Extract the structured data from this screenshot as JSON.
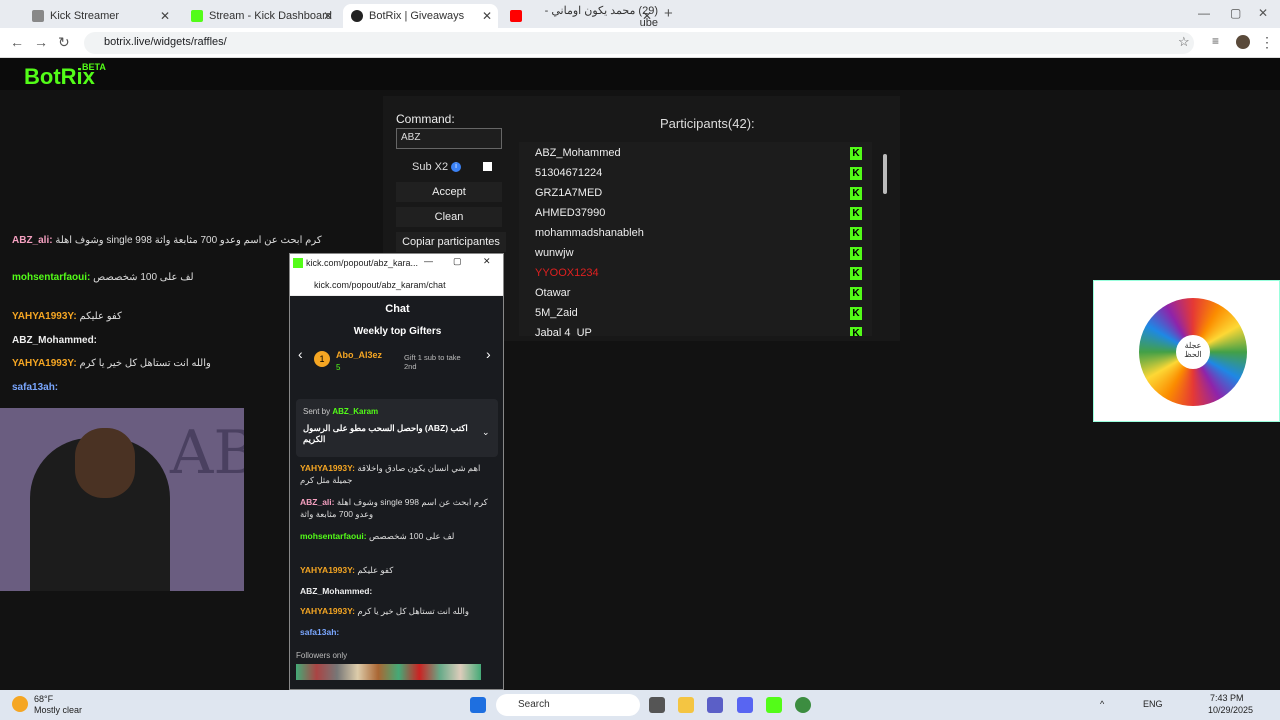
{
  "browser": {
    "tabs": [
      {
        "label": "Kick Streamer",
        "active": false
      },
      {
        "label": "Stream - Kick Dashboard",
        "active": false
      },
      {
        "label": "BotRix | Giveaways",
        "active": true
      },
      {
        "label": "(29) محمد يكون اوماني - ube",
        "active": false
      }
    ],
    "url": "botrix.live/widgets/raffles/"
  },
  "site": {
    "logo": "BotRix",
    "logo_badge": "BETA",
    "command_label": "Command:",
    "command_value": "ABZ",
    "sub_x2_label": "Sub X2",
    "accept_label": "Accept",
    "clean_label": "Clean",
    "copy_label": "Copiar participantes",
    "participants_title": "Participants(42):",
    "participants": [
      {
        "name": "ABZ_Mohammed",
        "highlight": false
      },
      {
        "name": "51304671224",
        "highlight": false
      },
      {
        "name": "GRZ1A7MED",
        "highlight": false
      },
      {
        "name": "AHMED37990",
        "highlight": false
      },
      {
        "name": "mohammadshanableh",
        "highlight": false
      },
      {
        "name": "wunwjw",
        "highlight": false
      },
      {
        "name": "YYOOX1234",
        "highlight": true
      },
      {
        "name": "Otawar",
        "highlight": false
      },
      {
        "name": "5M_Zaid",
        "highlight": false
      },
      {
        "name": "Jabal 4_UP",
        "highlight": false
      }
    ],
    "wheel_label": "عجلة الحظ"
  },
  "stream_chat": [
    {
      "user": "ABZ_ali:",
      "text": "وشوف اهلة single 998 كرم ابحث عن اسم وعدو 700 مثابعة واثة"
    },
    {
      "user": "mohsentarfaoui:",
      "text": "لف على 100 شخصصص"
    },
    {
      "user": "YAHYA1993Y:",
      "text": "كفو عليكم"
    },
    {
      "user": "ABZ_Mohammed:",
      "text": ""
    },
    {
      "user": "YAHYA1993Y:",
      "text": "والله انت تستاهل كل خير يا كرم"
    },
    {
      "user": "safa13ah:",
      "text": ""
    }
  ],
  "popup": {
    "title": "kick.com/popout/abz_kara...",
    "url": "kick.com/popout/abz_karam/chat",
    "chat_header": "Chat",
    "gifters_title": "Weekly top Gifters",
    "top_gifter": "Abo_Al3ez",
    "top_gifter_count": "5",
    "gift_hint": "Gift 1 sub to take 2nd",
    "pinned_by": "Sent by",
    "pinned_user": "ABZ_Karam",
    "pinned_text": "واحصل السحب مطو على الرسول (ABZ) اكتب الكريم",
    "messages": [
      {
        "user": "YAHYA1993Y:",
        "text": "اهم شي انسان يكون صادق واخلاقة جميلة مثل كرم",
        "color": "yellow"
      },
      {
        "user": "ABZ_ali:",
        "text": "وشوف اهلة single 998 كرم ابحث عن اسم وعدو 700 مثابعة واثة",
        "color": "pink"
      },
      {
        "user": "mohsentarfaoui:",
        "text": "لف على 100 شخصصص",
        "color": "green"
      },
      {
        "user": "YAHYA1993Y:",
        "text": "كفو عليكم",
        "color": "yellow"
      },
      {
        "user": "ABZ_Mohammed:",
        "text": "",
        "color": "white"
      },
      {
        "user": "YAHYA1993Y:",
        "text": "والله انت تستاهل كل خير يا كرم",
        "color": "yellow"
      },
      {
        "user": "safa13ah:",
        "text": "",
        "color": "blue"
      }
    ],
    "followers_only": "Followers only"
  },
  "taskbar": {
    "weather_temp": "68°F",
    "weather_desc": "Mostly clear",
    "search_placeholder": "Search",
    "lang": "ENG",
    "time": "7:43 PM",
    "date": "10/29/2025"
  }
}
